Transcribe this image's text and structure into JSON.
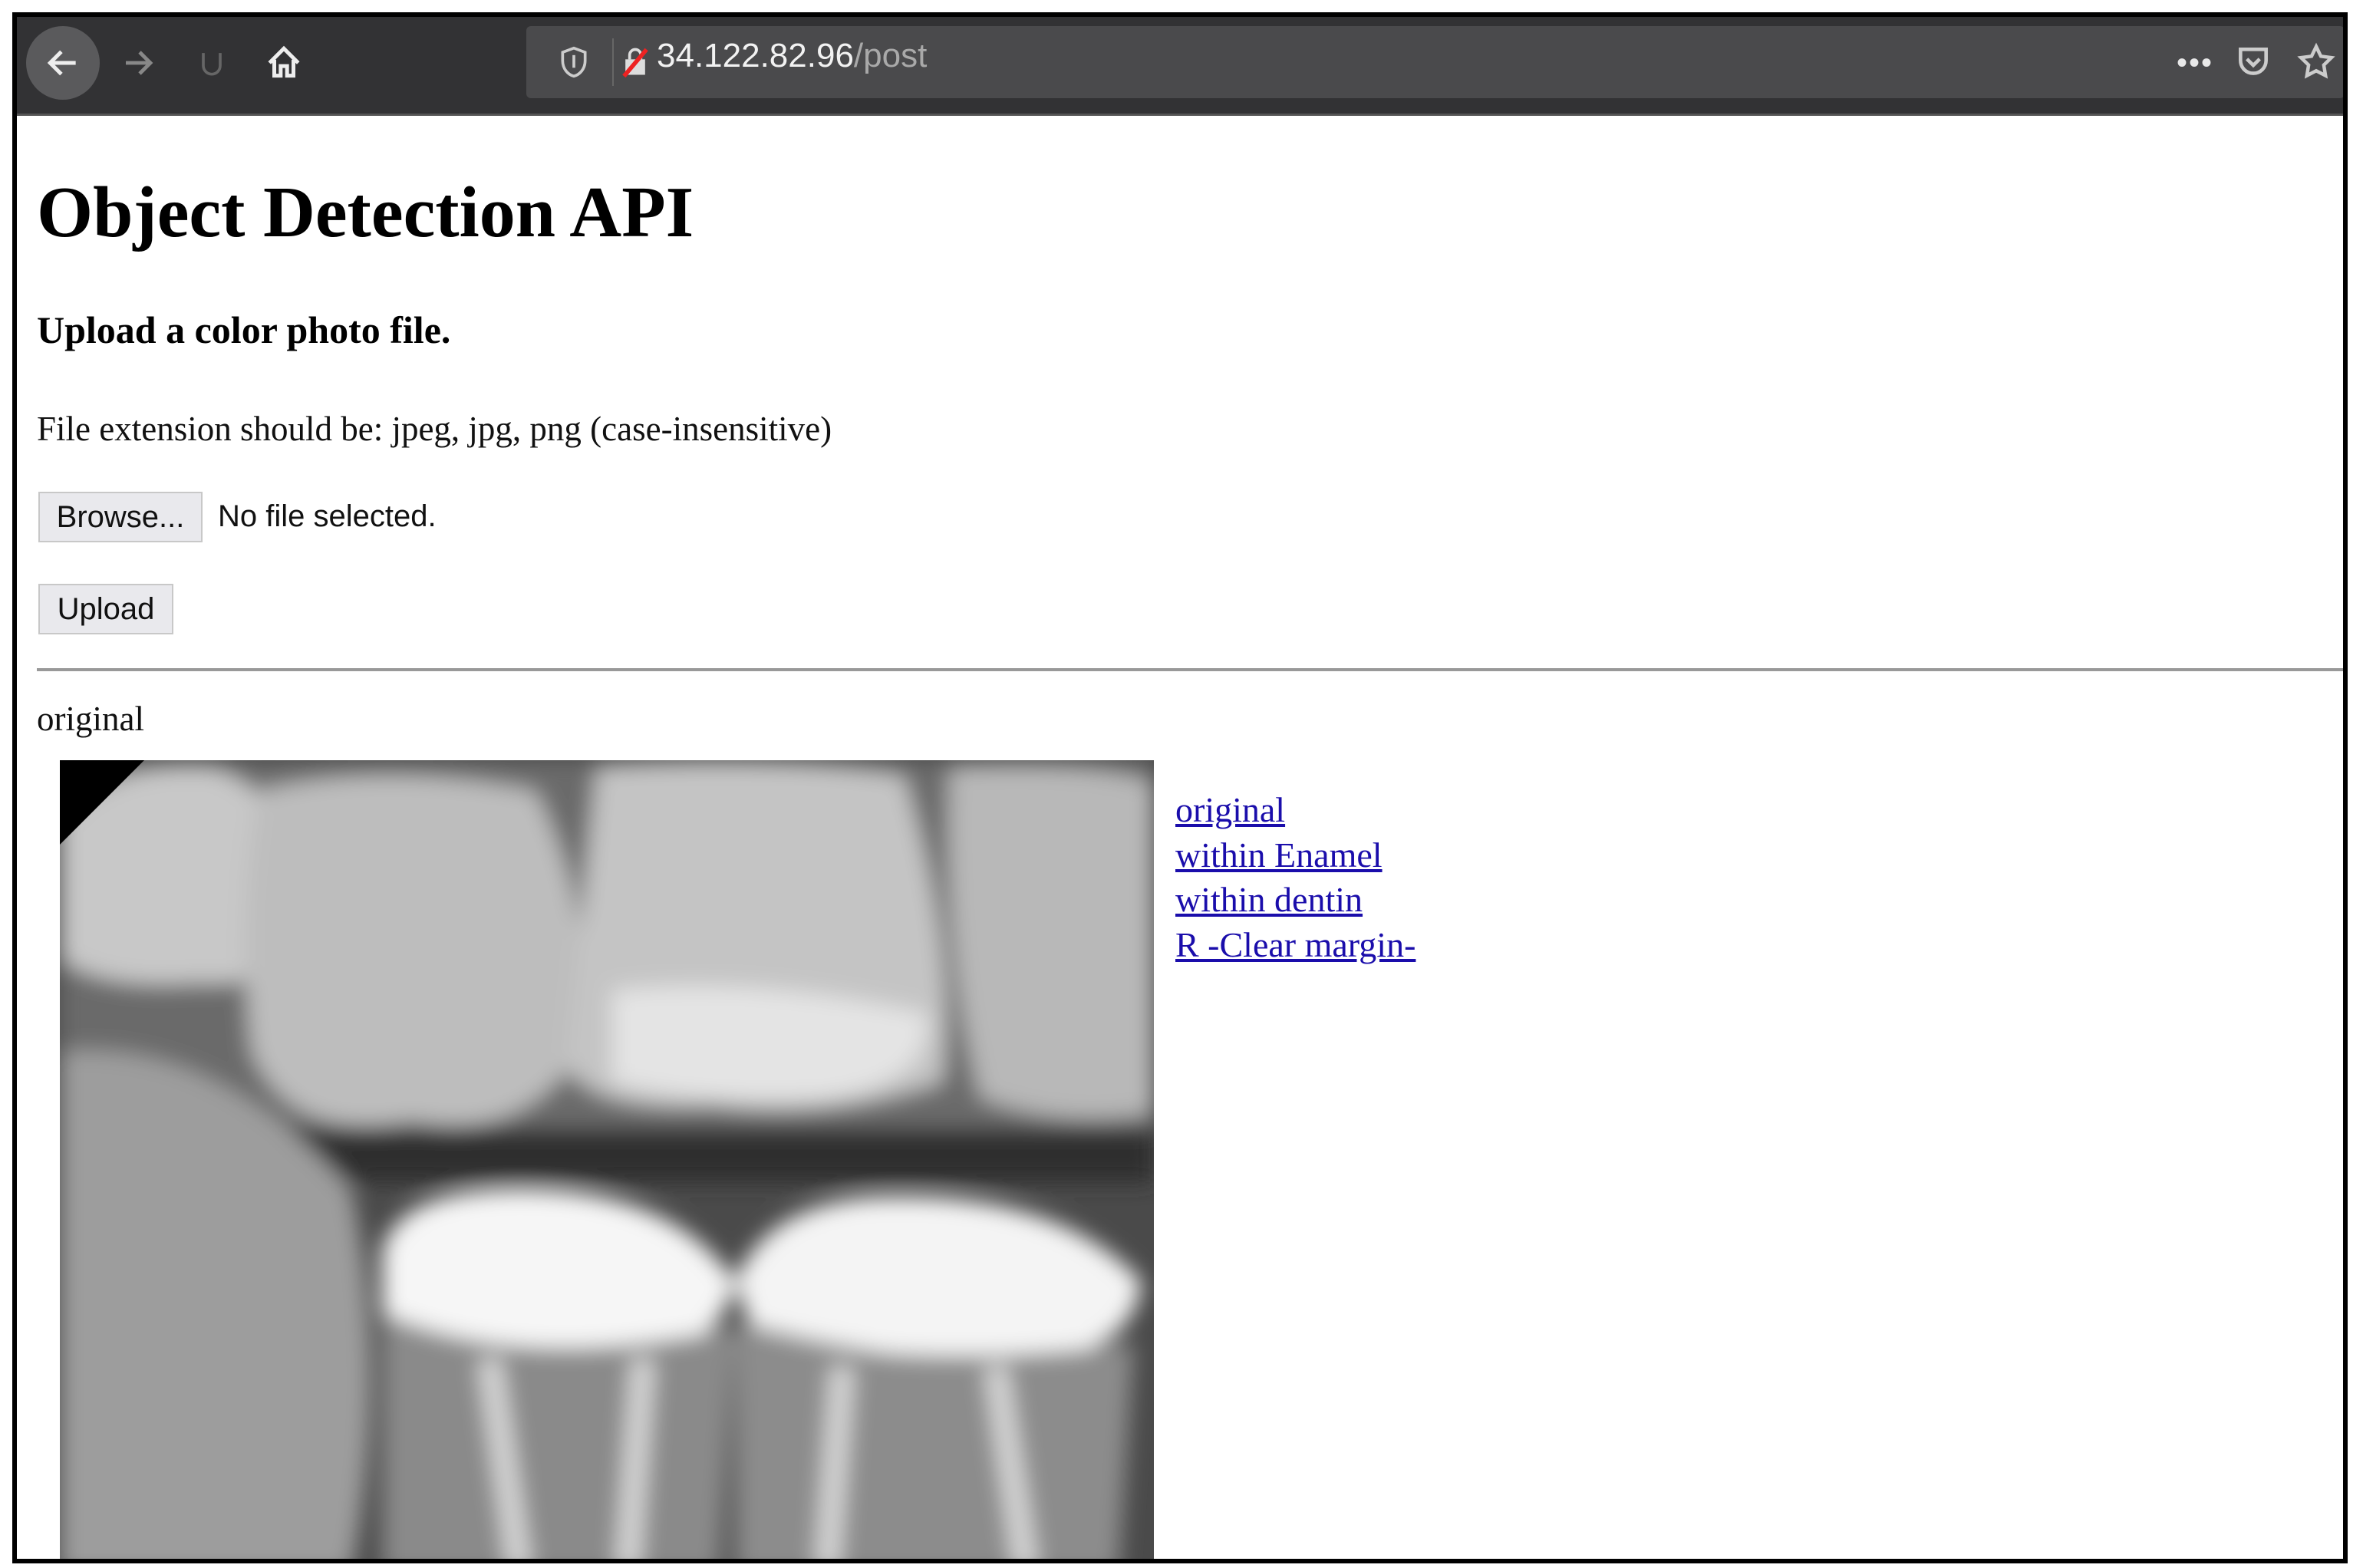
{
  "browser": {
    "url_host": "34.122.82.96",
    "url_path": "/post",
    "icons": [
      "back-arrow-icon",
      "forward-arrow-icon",
      "reload-icon",
      "home-icon",
      "shield-icon",
      "insecure-lock-icon",
      "more-icon",
      "pocket-icon",
      "star-icon"
    ]
  },
  "page": {
    "title": "Object Detection API",
    "subtitle": "Upload a color photo file.",
    "extension_note": "File extension should be: jpeg, jpg, png (case-insensitive)",
    "browse_label": "Browse...",
    "no_file_text": "No file selected.",
    "upload_label": "Upload",
    "section_label": "original",
    "links": [
      "original",
      "within Enamel",
      "within dentin",
      "R -Clear margin-"
    ]
  }
}
